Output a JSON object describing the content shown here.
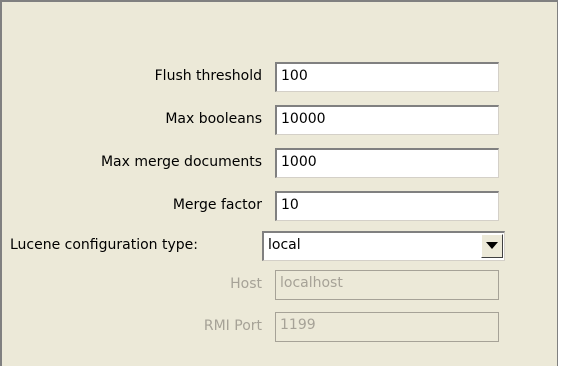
{
  "form": {
    "flush_threshold": {
      "label": "Flush threshold",
      "value": "100"
    },
    "max_booleans": {
      "label": "Max booleans",
      "value": "10000"
    },
    "max_merge_documents": {
      "label": "Max merge documents",
      "value": "1000"
    },
    "merge_factor": {
      "label": "Merge factor",
      "value": "10"
    },
    "config_type": {
      "label": "Lucene configuration type:",
      "value": "local"
    },
    "host": {
      "label": "Host",
      "value": "localhost",
      "disabled": true
    },
    "rmi_port": {
      "label": "RMI Port",
      "value": "1199",
      "disabled": true
    }
  }
}
